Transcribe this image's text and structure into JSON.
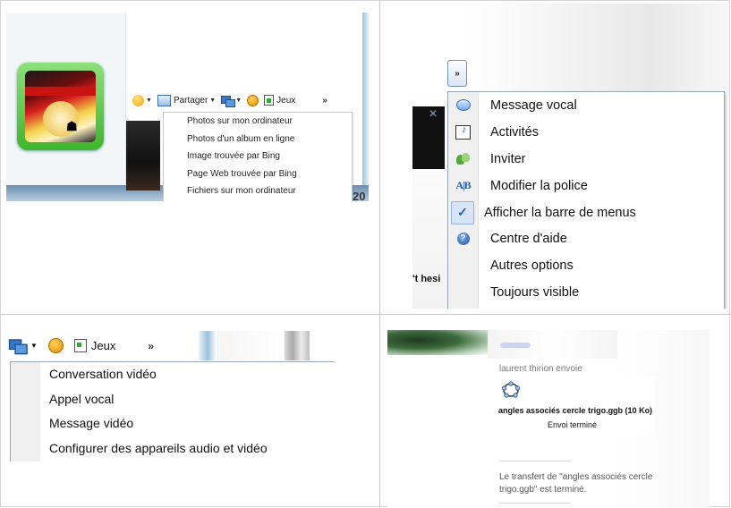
{
  "panel1": {
    "toolbar": {
      "share_label": "Partager",
      "games_label": "Jeux",
      "more_label": "»"
    },
    "share_menu": [
      "Photos sur mon ordinateur",
      "Photos d'un album en ligne",
      "Image trouvée par Bing",
      "Page Web trouvée par Bing",
      "Fichiers sur mon ordinateur"
    ],
    "partial_number": "20"
  },
  "panel2": {
    "more_button": "»",
    "partial_text": "'t hesi",
    "close_glyph": "✕",
    "menu": [
      {
        "label": "Message vocal",
        "icon": "speech-bubble-icon"
      },
      {
        "label": "Activités",
        "icon": "activities-icon"
      },
      {
        "label": "Inviter",
        "icon": "invite-contacts-icon"
      },
      {
        "label": "Modifier la police",
        "icon": "font-icon"
      },
      {
        "label": "Afficher la barre de menus",
        "icon": "checkmark-icon",
        "checked": true
      },
      {
        "label": "Centre d'aide",
        "icon": "help-icon"
      },
      {
        "label": "Autres options",
        "icon": ""
      },
      {
        "label": "Toujours visible",
        "icon": ""
      }
    ]
  },
  "panel3": {
    "toolbar": {
      "games_label": "Jeux",
      "more_label": "»"
    },
    "video_menu": [
      "Conversation vidéo",
      "Appel vocal",
      "Message vidéo",
      "Configurer des appareils audio et vidéo"
    ]
  },
  "panel4": {
    "sender_line": "laurent thirion envoie",
    "file_name": "angles associés cercle trigo.ggb (10 Ko)",
    "send_status": "Envoi terminé",
    "transfer_message": "Le transfert de \"angles associés cercle trigo.ggb\" est terminé."
  },
  "colors": {
    "avatar_frame": "#3fb52c",
    "menu_gutter": "#f0f0f0",
    "checked_highlight": "#d6e4f6",
    "accent_blue": "#1f5fb4"
  }
}
